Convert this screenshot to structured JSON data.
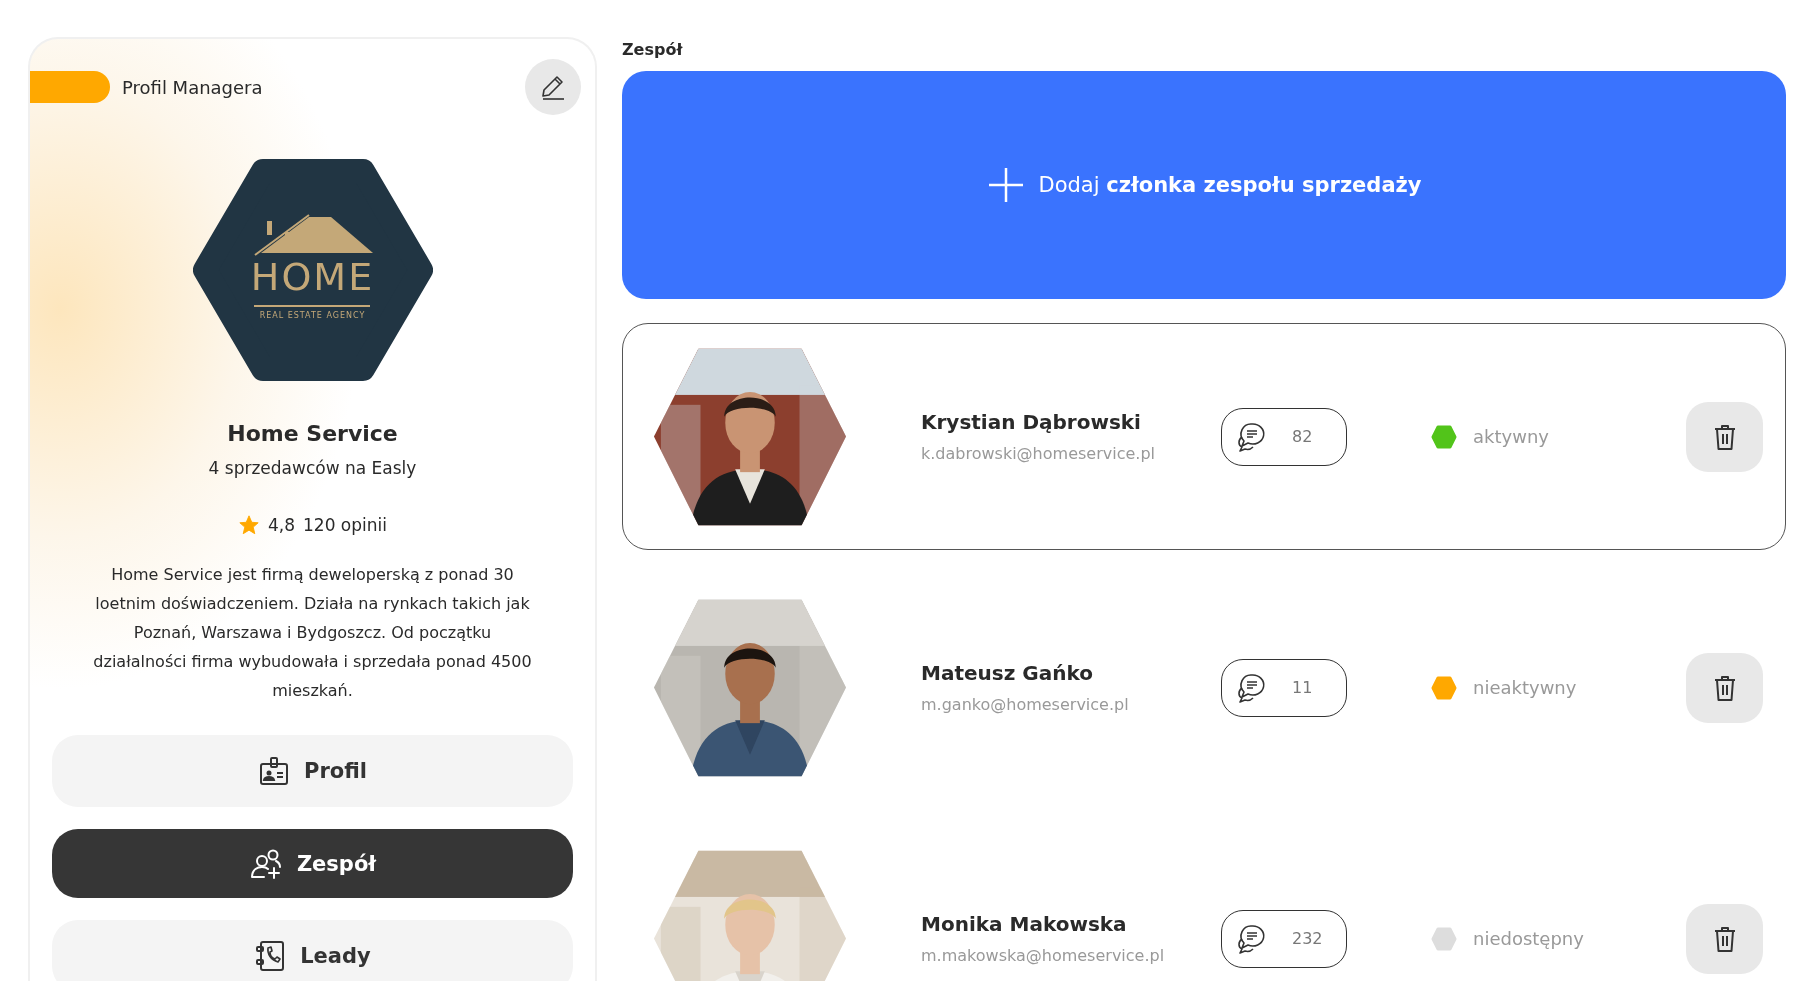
{
  "header": {
    "label": "Profil Managera"
  },
  "logo": {
    "wordmark": "HOME",
    "tagline": "REAL ESTATE AGENCY"
  },
  "company": {
    "name": "Home Service",
    "subtitle": "4 sprzedawców na Easly",
    "rating": "4,8",
    "reviews": "120 opinii",
    "description": "Home Service jest firmą deweloperską z ponad 30 loetnim doświadczeniem. Działa na rynkach takich jak Poznań, Warszawa i Bydgoszcz. Od początku działalności firma wybudowała i sprzedała ponad 4500 mieszkań."
  },
  "nav": [
    {
      "label": "Profil",
      "kind": "badge",
      "selected": false
    },
    {
      "label": "Zespół",
      "kind": "team",
      "selected": true
    },
    {
      "label": "Leady",
      "kind": "phonebook",
      "selected": false
    }
  ],
  "team": {
    "title": "Zespół",
    "add_button": "Dodaj **członka zespołu sprzedaży**",
    "members": [
      {
        "name": "Krystian Dąbrowski",
        "email": "k.dabrowski@homeservice.pl",
        "messages": "82",
        "status": "aktywny",
        "color": "#52c41a",
        "selected": true
      },
      {
        "name": "Mateusz Gańko",
        "email": "m.ganko@homeservice.pl",
        "messages": "11",
        "status": "nieaktywny",
        "color": "#ffa800",
        "selected": false
      },
      {
        "name": "Monika Makowska",
        "email": "m.makowska@homeservice.pl",
        "messages": "232",
        "status": "niedostępny",
        "color": "#dddddd",
        "selected": false
      }
    ]
  }
}
